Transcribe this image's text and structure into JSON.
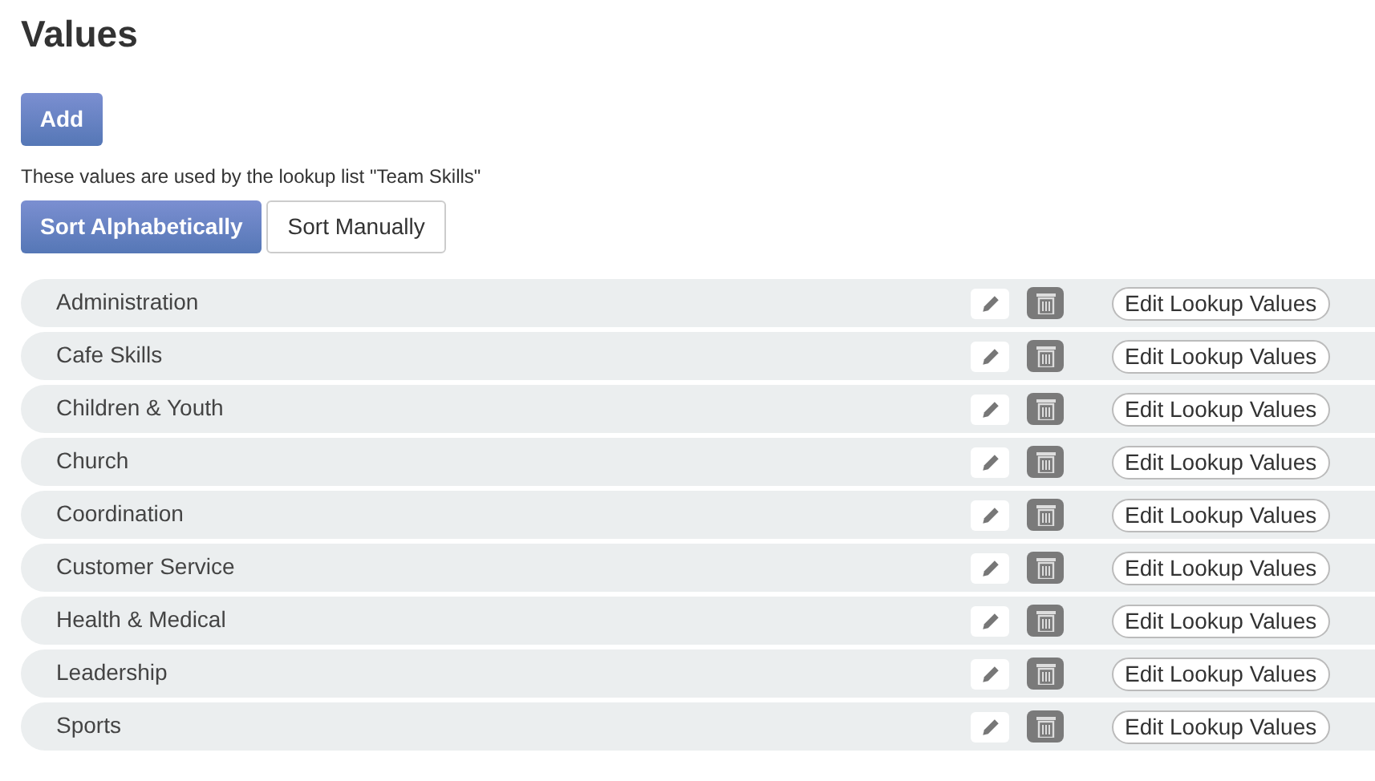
{
  "title": "Values",
  "add_button": "Add",
  "description": "These values are used by the lookup list \"Team Skills\"",
  "sort_options": [
    {
      "label": "Sort Alphabetically",
      "selected": true
    },
    {
      "label": "Sort Manually",
      "selected": false
    }
  ],
  "rows": [
    {
      "name": "Administration",
      "action": "Edit Lookup Values"
    },
    {
      "name": "Cafe Skills",
      "action": "Edit Lookup Values"
    },
    {
      "name": "Children & Youth",
      "action": "Edit Lookup Values"
    },
    {
      "name": "Church",
      "action": "Edit Lookup Values"
    },
    {
      "name": "Coordination",
      "action": "Edit Lookup Values"
    },
    {
      "name": "Customer Service",
      "action": "Edit Lookup Values"
    },
    {
      "name": "Health & Medical",
      "action": "Edit Lookup Values"
    },
    {
      "name": "Leadership",
      "action": "Edit Lookup Values"
    },
    {
      "name": "Sports",
      "action": "Edit Lookup Values"
    }
  ]
}
